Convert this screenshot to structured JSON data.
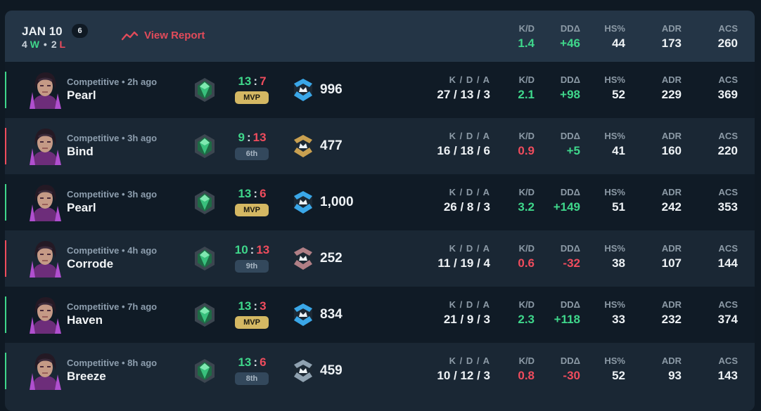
{
  "header": {
    "date": "JAN 10",
    "match_count": "6",
    "wins_num": "4",
    "wins_letter": "W",
    "losses_num": "2",
    "losses_letter": "L",
    "report_label": "View Report",
    "report_icon": "trend-line-icon",
    "stats": [
      {
        "label": "K/D",
        "value": "1.4",
        "tone": "g"
      },
      {
        "label": "DDΔ",
        "value": "+46",
        "tone": "g"
      },
      {
        "label": "HS%",
        "value": "44",
        "tone": ""
      },
      {
        "label": "ADR",
        "value": "173",
        "tone": ""
      },
      {
        "label": "ACS",
        "value": "260",
        "tone": ""
      }
    ]
  },
  "colors": {
    "win": "#3fd78b",
    "loss": "#ef4c5d",
    "mvp": "#d4b863",
    "report": "#e24b5a"
  },
  "matches": [
    {
      "mode": "Competitive • 2h ago",
      "map": "Pearl",
      "result": "win",
      "score_us": "13",
      "score_them": "7",
      "placement": "MVP",
      "rr": "996",
      "kda_label": "K / D / A",
      "kda": "27 / 13 / 3",
      "stats": [
        {
          "label": "K/D",
          "value": "2.1",
          "tone": "g"
        },
        {
          "label": "DDΔ",
          "value": "+98",
          "tone": "g"
        },
        {
          "label": "HS%",
          "value": "52",
          "tone": ""
        },
        {
          "label": "ADR",
          "value": "229",
          "tone": ""
        },
        {
          "label": "ACS",
          "value": "369",
          "tone": ""
        }
      ]
    },
    {
      "mode": "Competitive • 3h ago",
      "map": "Bind",
      "result": "loss",
      "score_us": "9",
      "score_them": "13",
      "placement": "6th",
      "rr": "477",
      "kda_label": "K / D / A",
      "kda": "16 / 18 / 6",
      "stats": [
        {
          "label": "K/D",
          "value": "0.9",
          "tone": "r"
        },
        {
          "label": "DDΔ",
          "value": "+5",
          "tone": "g"
        },
        {
          "label": "HS%",
          "value": "41",
          "tone": ""
        },
        {
          "label": "ADR",
          "value": "160",
          "tone": ""
        },
        {
          "label": "ACS",
          "value": "220",
          "tone": ""
        }
      ]
    },
    {
      "mode": "Competitive • 3h ago",
      "map": "Pearl",
      "result": "win",
      "score_us": "13",
      "score_them": "6",
      "placement": "MVP",
      "rr": "1,000",
      "kda_label": "K / D / A",
      "kda": "26 / 8 / 3",
      "stats": [
        {
          "label": "K/D",
          "value": "3.2",
          "tone": "g"
        },
        {
          "label": "DDΔ",
          "value": "+149",
          "tone": "g"
        },
        {
          "label": "HS%",
          "value": "51",
          "tone": ""
        },
        {
          "label": "ADR",
          "value": "242",
          "tone": ""
        },
        {
          "label": "ACS",
          "value": "353",
          "tone": ""
        }
      ]
    },
    {
      "mode": "Competitive • 4h ago",
      "map": "Corrode",
      "result": "loss",
      "score_us": "10",
      "score_them": "13",
      "placement": "9th",
      "rr": "252",
      "kda_label": "K / D / A",
      "kda": "11 / 19 / 4",
      "stats": [
        {
          "label": "K/D",
          "value": "0.6",
          "tone": "r"
        },
        {
          "label": "DDΔ",
          "value": "-32",
          "tone": "r"
        },
        {
          "label": "HS%",
          "value": "38",
          "tone": ""
        },
        {
          "label": "ADR",
          "value": "107",
          "tone": ""
        },
        {
          "label": "ACS",
          "value": "144",
          "tone": ""
        }
      ]
    },
    {
      "mode": "Competitive • 7h ago",
      "map": "Haven",
      "result": "win",
      "score_us": "13",
      "score_them": "3",
      "placement": "MVP",
      "rr": "834",
      "kda_label": "K / D / A",
      "kda": "21 / 9 / 3",
      "stats": [
        {
          "label": "K/D",
          "value": "2.3",
          "tone": "g"
        },
        {
          "label": "DDΔ",
          "value": "+118",
          "tone": "g"
        },
        {
          "label": "HS%",
          "value": "33",
          "tone": ""
        },
        {
          "label": "ADR",
          "value": "232",
          "tone": ""
        },
        {
          "label": "ACS",
          "value": "374",
          "tone": ""
        }
      ]
    },
    {
      "mode": "Competitive • 8h ago",
      "map": "Breeze",
      "result": "win",
      "score_us": "13",
      "score_them": "6",
      "placement": "8th",
      "rr": "459",
      "kda_label": "K / D / A",
      "kda": "10 / 12 / 3",
      "stats": [
        {
          "label": "K/D",
          "value": "0.8",
          "tone": "r"
        },
        {
          "label": "DDΔ",
          "value": "-30",
          "tone": "r"
        },
        {
          "label": "HS%",
          "value": "52",
          "tone": ""
        },
        {
          "label": "ADR",
          "value": "93",
          "tone": ""
        },
        {
          "label": "ACS",
          "value": "143",
          "tone": ""
        }
      ]
    }
  ]
}
